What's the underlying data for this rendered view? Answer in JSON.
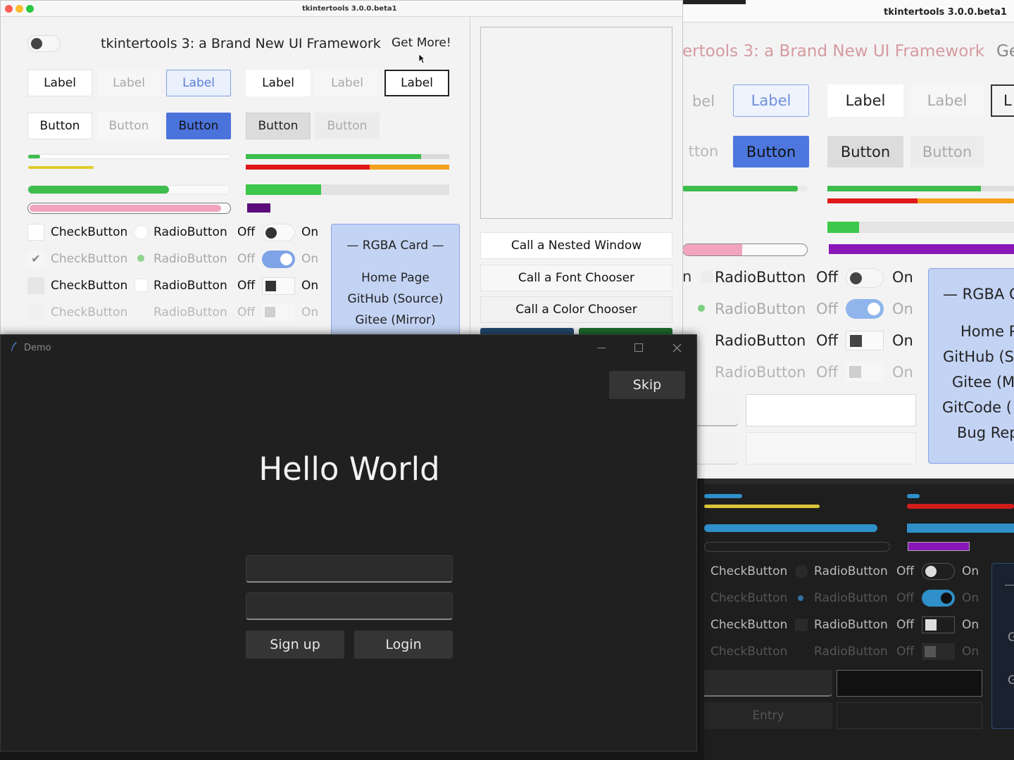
{
  "win_main": {
    "title": "tkintertools 3.0.0.beta1",
    "headline": "tkintertools 3: a Brand New UI Framework",
    "get_more": "Get More!",
    "labels": [
      "Label",
      "Label",
      "Label",
      "Label",
      "Label",
      "Label"
    ],
    "buttons": [
      "Button",
      "Button",
      "Button",
      "Button",
      "Button"
    ],
    "check": "CheckButton",
    "radio": "RadioButton",
    "off": "Off",
    "on": "On",
    "card_title": "— RGBA Card —",
    "card_links": [
      "Home Page",
      "GitHub (Source)",
      "Gitee (Mirror)"
    ],
    "call_buttons": [
      "Call a Nested Window",
      "Call a Font Chooser",
      "Call a Color Chooser"
    ],
    "progress": {
      "green_small": 0.06,
      "green_big": 0.7,
      "pink": 0.96,
      "right_green": 0.86,
      "right_red": 0.61,
      "right_block": 0.37
    }
  },
  "win_back": {
    "title": "tkintertools 3.0.0.beta1",
    "headline": "ertools 3: a Brand New UI Framework",
    "headline_tail": "Ge",
    "labels": [
      "bel",
      "Label",
      "Label",
      "Label",
      "L"
    ],
    "buttons": [
      "tton",
      "Button",
      "Button",
      "Button"
    ],
    "radio": "RadioButton",
    "off": "Off",
    "on": "On",
    "card_title": "— RGBA C",
    "card_links": [
      "Home P",
      "GitHub (S",
      "Gitee (M",
      "GitCode (",
      "Bug Rep"
    ],
    "partial_n": "n"
  },
  "win_dark": {
    "check": "CheckButton",
    "radio": "RadioButton",
    "off": "Off",
    "on": "On",
    "entry": "Entry",
    "card_letters": [
      "G",
      "G"
    ]
  },
  "demo": {
    "title": "Demo",
    "skip": "Skip",
    "hello": "Hello World",
    "username_value": "",
    "password_value": "",
    "signup": "Sign up",
    "login": "Login"
  }
}
